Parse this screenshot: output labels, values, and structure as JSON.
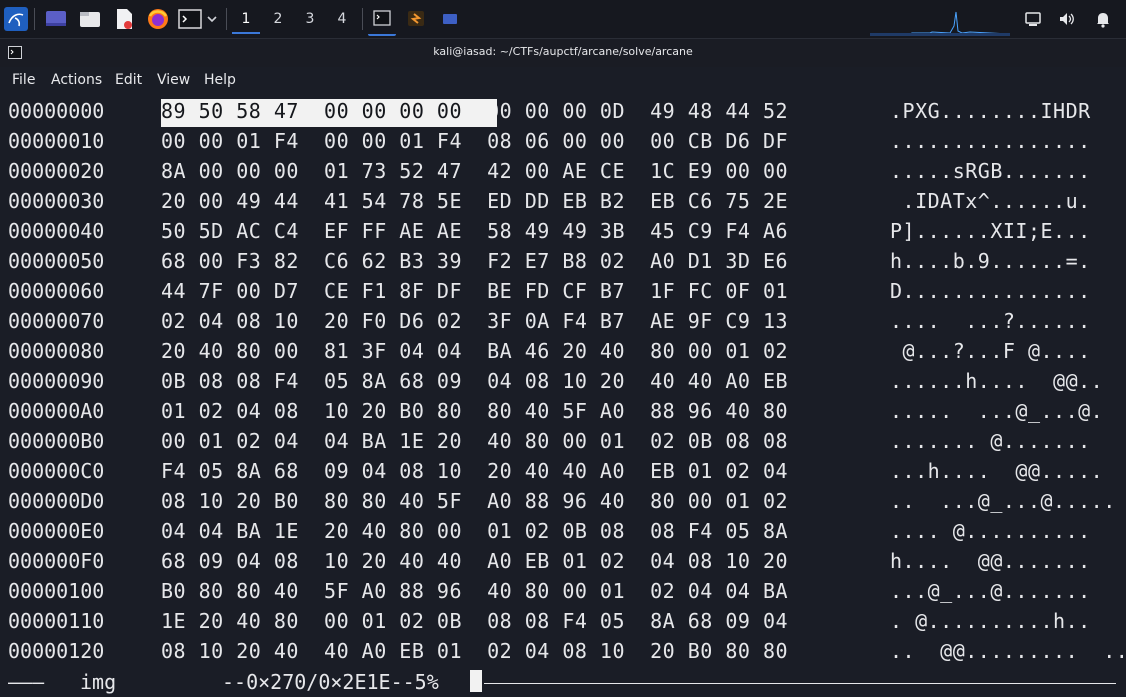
{
  "taskbar": {
    "workspaces": [
      "1",
      "2",
      "3",
      "4"
    ],
    "accent": "#3b78d8"
  },
  "window": {
    "title": "kali@iasad: ~/CTFs/aupctf/arcane/solve/arcane"
  },
  "menu": {
    "items": [
      "File",
      "Actions",
      "Edit",
      "View",
      "Help"
    ]
  },
  "hex": {
    "highlight_bytes": "89 50 58 47  00 00 00 00",
    "rows": [
      {
        "addr": "00000000",
        "bytes": "89 50 58 47  00 00 00 00  00 00 00 0D  49 48 44 52",
        "ascii": ".PXG........IHDR"
      },
      {
        "addr": "00000010",
        "bytes": "00 00 01 F4  00 00 01 F4  08 06 00 00  00 CB D6 DF",
        "ascii": "................"
      },
      {
        "addr": "00000020",
        "bytes": "8A 00 00 00  01 73 52 47  42 00 AE CE  1C E9 00 00",
        "ascii": ".....sRGB......."
      },
      {
        "addr": "00000030",
        "bytes": "20 00 49 44  41 54 78 5E  ED DD EB B2  EB C6 75 2E",
        "ascii": " .IDATx^......u."
      },
      {
        "addr": "00000040",
        "bytes": "50 5D AC C4  EF FF AE AE  58 49 49 3B  45 C9 F4 A6",
        "ascii": "P]......XII;E..."
      },
      {
        "addr": "00000050",
        "bytes": "68 00 F3 82  C6 62 B3 39  F2 E7 B8 02  A0 D1 3D E6",
        "ascii": "h....b.9......=."
      },
      {
        "addr": "00000060",
        "bytes": "44 7F 00 D7  CE F1 8F DF  BE FD CF B7  1F FC 0F 01",
        "ascii": "D..............."
      },
      {
        "addr": "00000070",
        "bytes": "02 04 08 10  20 F0 D6 02  3F 0A F4 B7  AE 9F C9 13",
        "ascii": "....  ...?......"
      },
      {
        "addr": "00000080",
        "bytes": "20 40 80 00  81 3F 04 04  BA 46 20 40  80 00 01 02",
        "ascii": " @...?...F @...."
      },
      {
        "addr": "00000090",
        "bytes": "0B 08 08 F4  05 8A 68 09  04 08 10 20  40 40 A0 EB",
        "ascii": "......h....  @@.."
      },
      {
        "addr": "000000A0",
        "bytes": "01 02 04 08  10 20 B0 80  80 40 5F A0  88 96 40 80",
        "ascii": ".....  ...@_...@."
      },
      {
        "addr": "000000B0",
        "bytes": "00 01 02 04  04 BA 1E 20  40 80 00 01  02 0B 08 08",
        "ascii": "....... @......."
      },
      {
        "addr": "000000C0",
        "bytes": "F4 05 8A 68  09 04 08 10  20 40 40 A0  EB 01 02 04",
        "ascii": "...h....  @@....."
      },
      {
        "addr": "000000D0",
        "bytes": "08 10 20 B0  80 80 40 5F  A0 88 96 40  80 00 01 02",
        "ascii": "..  ...@_...@....."
      },
      {
        "addr": "000000E0",
        "bytes": "04 04 BA 1E  20 40 80 00  01 02 0B 08  08 F4 05 8A",
        "ascii": ".... @.........."
      },
      {
        "addr": "000000F0",
        "bytes": "68 09 04 08  10 20 40 40  A0 EB 01 02  04 08 10 20",
        "ascii": "h....  @@......."
      },
      {
        "addr": "00000100",
        "bytes": "B0 80 80 40  5F A0 88 96  40 80 00 01  02 04 04 BA",
        "ascii": "...@_...@......."
      },
      {
        "addr": "00000110",
        "bytes": "1E 20 40 80  00 01 02 0B  08 08 F4 05  8A 68 09 04",
        "ascii": ". @..........h.."
      },
      {
        "addr": "00000120",
        "bytes": "08 10 20 40  40 A0 EB 01  02 04 08 10  20 B0 80 80",
        "ascii": "..  @@.........  ..."
      }
    ]
  },
  "status": {
    "dashes": "———",
    "file": "img",
    "position": "--0×270/0×2E1E--5%"
  }
}
